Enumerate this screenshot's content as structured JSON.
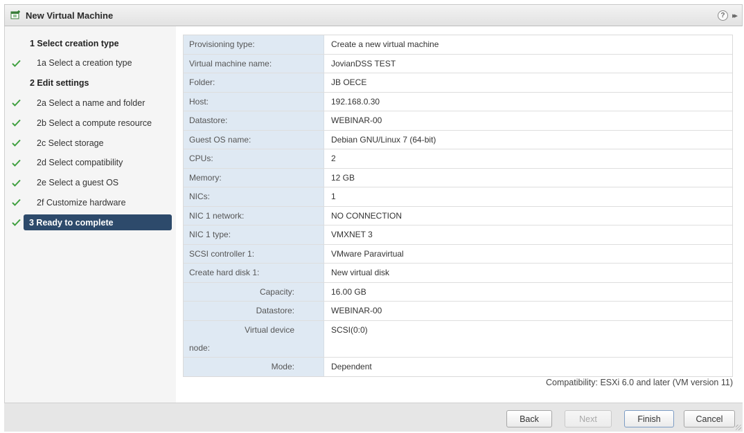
{
  "window": {
    "title": "New Virtual Machine",
    "help_icon": "?",
    "expand_icon": "▸▸"
  },
  "sidebar": {
    "steps": [
      {
        "label": "1 Select creation type",
        "level": "main",
        "checked": false
      },
      {
        "label": "1a Select a creation type",
        "level": "sub",
        "checked": true
      },
      {
        "label": "2 Edit settings",
        "level": "main",
        "checked": false
      },
      {
        "label": "2a Select a name and folder",
        "level": "sub",
        "checked": true
      },
      {
        "label": "2b Select a compute resource",
        "level": "sub",
        "checked": true
      },
      {
        "label": "2c Select storage",
        "level": "sub",
        "checked": true
      },
      {
        "label": "2d Select compatibility",
        "level": "sub",
        "checked": true
      },
      {
        "label": "2e Select a guest OS",
        "level": "sub",
        "checked": true
      },
      {
        "label": "2f Customize hardware",
        "level": "sub",
        "checked": true
      },
      {
        "label": "3 Ready to complete",
        "level": "main",
        "checked": true,
        "active": true
      }
    ]
  },
  "summary": {
    "rows": [
      {
        "key": "Provisioning type:",
        "value": "Create a new virtual machine"
      },
      {
        "key": "Virtual machine name:",
        "value": "JovianDSS TEST"
      },
      {
        "key": "Folder:",
        "value": "JB OECE"
      },
      {
        "key": "Host:",
        "value": "192.168.0.30"
      },
      {
        "key": "Datastore:",
        "value": "WEBINAR-00"
      },
      {
        "key": "Guest OS name:",
        "value": "Debian GNU/Linux 7 (64-bit)"
      },
      {
        "key": "CPUs:",
        "value": "2"
      },
      {
        "key": "Memory:",
        "value": "12 GB"
      },
      {
        "key": "NICs:",
        "value": "1"
      },
      {
        "key": "NIC 1 network:",
        "value": "NO CONNECTION"
      },
      {
        "key": "NIC 1 type:",
        "value": "VMXNET 3"
      },
      {
        "key": "SCSI controller 1:",
        "value": "VMware Paravirtual"
      },
      {
        "key": "Create hard disk 1:",
        "value": "New virtual disk"
      },
      {
        "key": "Capacity:",
        "value": "16.00 GB",
        "indent": true
      },
      {
        "key": "Datastore:",
        "value": "WEBINAR-00",
        "indent": true
      },
      {
        "key": "Virtual device",
        "key2": "node:",
        "value": "SCSI(0:0)",
        "indent": true,
        "tall": true
      },
      {
        "key": "Mode:",
        "value": "Dependent",
        "indent": true
      }
    ],
    "compatibility": "Compatibility: ESXi 6.0 and later (VM version 11)"
  },
  "footer": {
    "back_label": "Back",
    "next_label": "Next",
    "finish_label": "Finish",
    "cancel_label": "Cancel"
  },
  "colors": {
    "check_green": "#3f9f3f",
    "active_step_bg": "#2d4a6b",
    "key_cell_bg": "#dfe9f3"
  }
}
